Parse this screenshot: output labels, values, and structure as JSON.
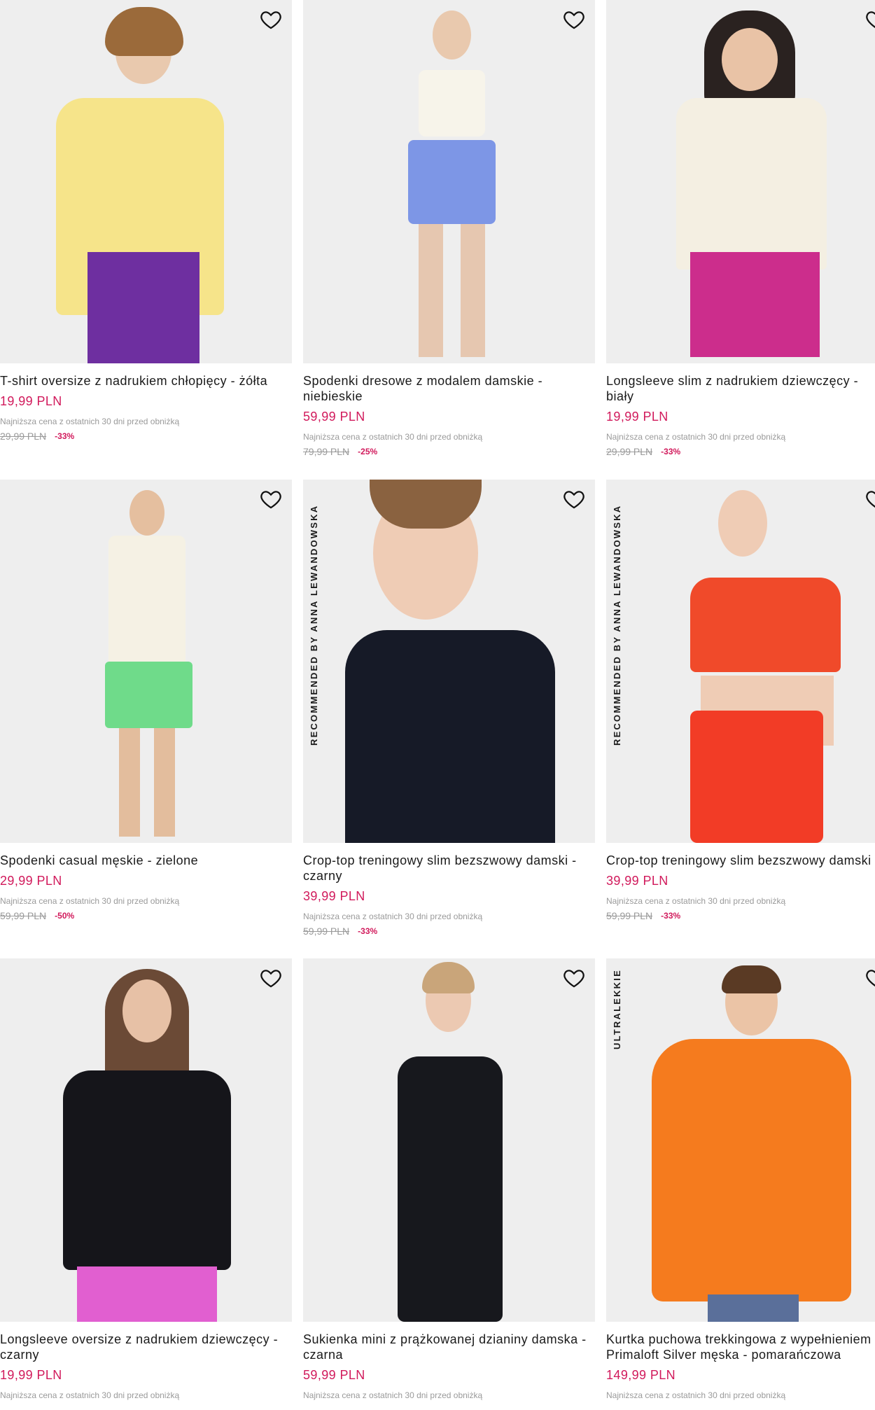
{
  "colors": {
    "price": "#d1195b",
    "muted": "#9a9a9a",
    "photo_bg": "#eeeeee"
  },
  "lowest_label": "Najniższa cena z ostatnich 30 dni przed obniżką",
  "products": [
    {
      "title": "T-shirt oversize z nadrukiem chłopięcy - żółta",
      "price": "19,99 PLN",
      "old_price": "29,99 PLN",
      "discount": "-33%"
    },
    {
      "title": "Spodenki dresowe z modalem damskie - niebieskie",
      "price": "59,99 PLN",
      "old_price": "79,99 PLN",
      "discount": "-25%"
    },
    {
      "title": "Longsleeve slim z nadrukiem dziewczęcy - biały",
      "price": "19,99 PLN",
      "old_price": "29,99 PLN",
      "discount": "-33%"
    },
    {
      "title": "Spodenki casual męskie - zielone",
      "price": "29,99 PLN",
      "old_price": "59,99 PLN",
      "discount": "-50%"
    },
    {
      "title": "Crop-top treningowy slim bezszwowy damski - czarny",
      "price": "39,99 PLN",
      "old_price": "59,99 PLN",
      "discount": "-33%",
      "tag": "RECOMMENDED BY ANNA LEWANDOWSKA"
    },
    {
      "title": "Crop-top treningowy slim bezszwowy damski - czerwony",
      "price": "39,99 PLN",
      "old_price": "59,99 PLN",
      "discount": "-33%",
      "tag": "RECOMMENDED BY ANNA LEWANDOWSKA"
    },
    {
      "title": "Longsleeve oversize z nadrukiem dziewczęcy - czarny",
      "price": "19,99 PLN"
    },
    {
      "title": "Sukienka mini z prążkowanej dzianiny damska - czarna",
      "price": "59,99 PLN"
    },
    {
      "title": "Kurtka puchowa trekkingowa z wypełnieniem Primaloft Silver męska - pomarańczowa",
      "price": "149,99 PLN",
      "tag": "ULTRALEKKIE"
    }
  ],
  "icons": {
    "wishlist": "heart-outline-icon"
  }
}
